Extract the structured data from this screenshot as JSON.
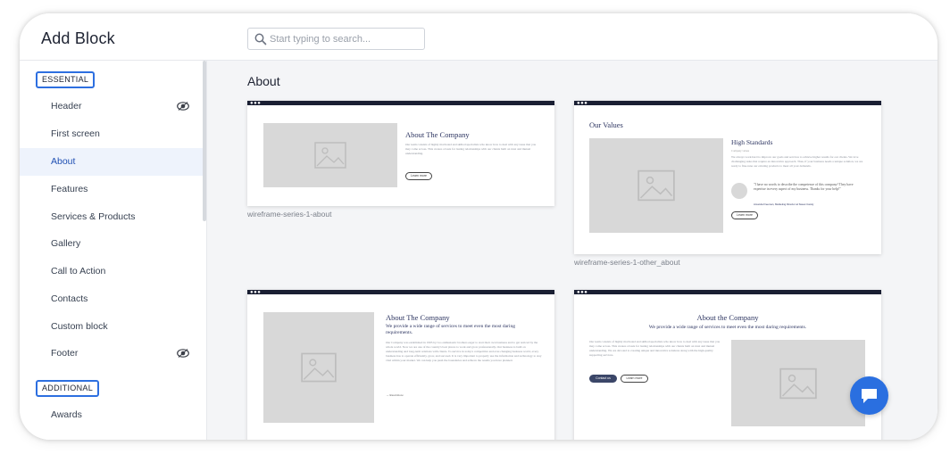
{
  "header": {
    "title": "Add Block",
    "search_placeholder": "Start typing to search..."
  },
  "sidebar": {
    "essential_label": "ESSENTIAL",
    "additional_label": "ADDITIONAL",
    "items": [
      {
        "label": "Header",
        "icon": "eye-icon"
      },
      {
        "label": "First screen"
      },
      {
        "label": "About",
        "active": true
      },
      {
        "label": "Features"
      },
      {
        "label": "Services & Products"
      },
      {
        "label": "Gallery"
      },
      {
        "label": "Call to Action"
      },
      {
        "label": "Contacts"
      },
      {
        "label": "Custom block"
      },
      {
        "label": "Footer",
        "icon": "eye-icon"
      }
    ],
    "additional_items": [
      {
        "label": "Awards"
      }
    ]
  },
  "main": {
    "section_title": "About",
    "cards": [
      {
        "caption": "wireframe-series-1-about",
        "heading": "About The Company",
        "text": "Our team consists of highly motivated and skilled specialists who know how to deal with any issue that you may come across. This creates a basis for lasting relationships with our clients built on trust and mutual understanding.",
        "button": "Learn more"
      },
      {
        "caption": "wireframe-series-1-other_about",
        "heading": "Our Values",
        "subheading": "High Standards",
        "small": "Company values",
        "text": "We always work hard to improve our goals and services to achieve higher results for our clients. We love challenging tasks that require an innovative approach. Thus, if your business needs a unique solution, we are ready to fine-tune our existing products to meet all your demands.",
        "quote": "\"I have no words to describe the competence of this company! They have expertise in every aspect of my business. Thanks for your help!\"",
        "signature": "Amanda Freeman, Marketing Director at Sweet Candy",
        "button": "Learn more"
      },
      {
        "heading": "About The Company",
        "subheading": "We provide a wide range of services to meet even the most daring requirements.",
        "text": "Our Company was established in 1995 by two enthusiastic brothers eager to start their own business and to get noticed by the whole world. Now we are one of the country's best places to work and grow professionally. Our business is built on understanding and long-term relations with clients. To survive in today's competitive and ever-changing business world, every business has to operate efficiently, grow, and succeed. It is very important to properly use the information and technology to stay vital within your market. We can help you push the boundaries and achieve the results you have planned.",
        "readmore": "Read more"
      },
      {
        "heading": "About the Company",
        "subheading": "We provide a wide range of services to meet even the most daring requirements.",
        "text": "Our team consists of highly motivated and skilled specialists who know how to deal with any issue that you may come across. This creates a basis for lasting relationships with our clients built on trust and mutual understanding. We are devoted to creating unique and innovative solutions along with the high-quality supporting services.",
        "button_primary": "Contact us",
        "button_secondary": "Learn more"
      }
    ]
  },
  "colors": {
    "accent": "#2a6fe0",
    "dark_bar": "#1a1f33",
    "heading": "#2d3561"
  }
}
